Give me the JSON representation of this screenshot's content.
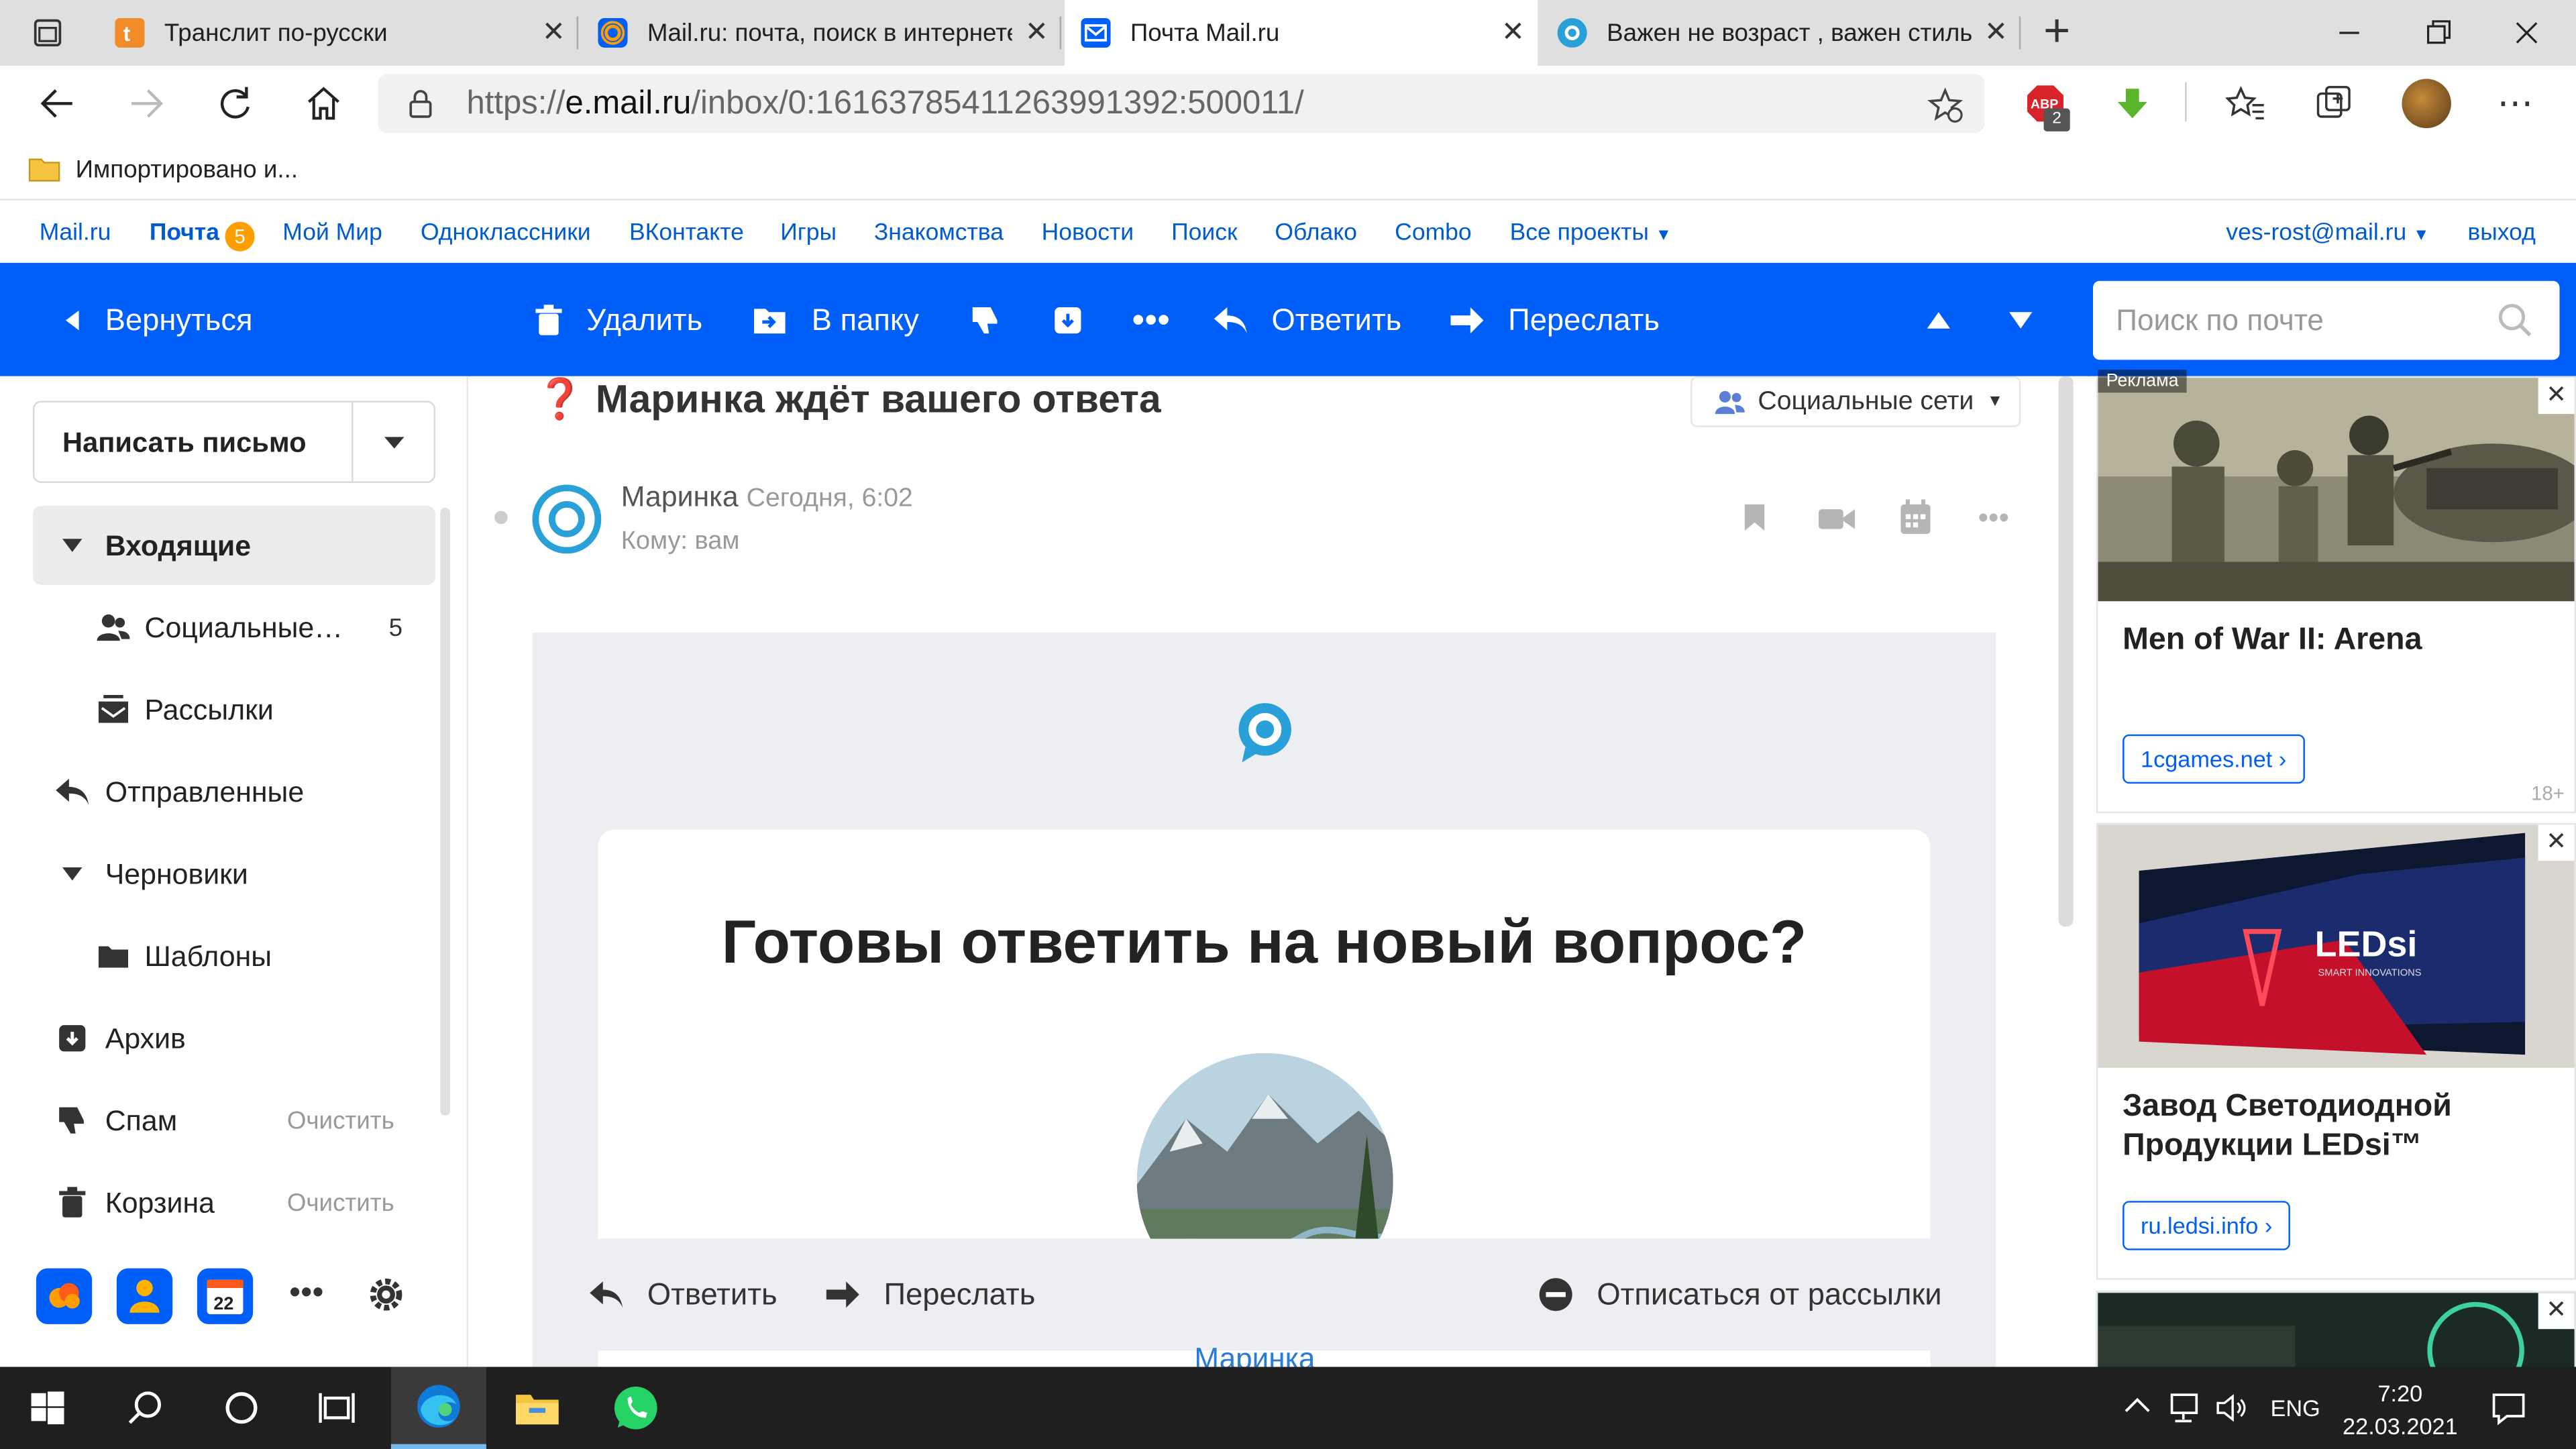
{
  "browser": {
    "tabs": [
      {
        "title": "Транслит по-русски",
        "icon": "translit-favicon"
      },
      {
        "title": "Mail.ru: почта, поиск в интернете",
        "icon": "mailru-at-favicon"
      },
      {
        "title": "Почта Mail.ru",
        "icon": "mail-envelope-favicon"
      },
      {
        "title": "Важен не возраст , важен стиль",
        "icon": "circle-favicon"
      }
    ],
    "new_tab": "+",
    "url_scheme": "https://",
    "url_domain": "e.mail.ru",
    "url_path": "/inbox/0:16163785411263991392:500011/",
    "adblock_badge": "2",
    "bookmark_folder": "Импортировано и..."
  },
  "portal_nav": {
    "items": [
      "Mail.ru",
      "Почта",
      "Мой Мир",
      "Одноклассники",
      "ВКонтакте",
      "Игры",
      "Знакомства",
      "Новости",
      "Поиск",
      "Облако",
      "Combo",
      "Все проекты"
    ],
    "mail_badge": "5",
    "user": "ves-rost@mail.ru",
    "logout": "выход"
  },
  "toolbar": {
    "back": "Вернуться",
    "delete": "Удалить",
    "to_folder": "В папку",
    "reply": "Ответить",
    "forward": "Переслать",
    "search_placeholder": "Поиск по почте"
  },
  "sidebar": {
    "compose": "Написать письмо",
    "folders": [
      {
        "label": "Входящие",
        "icon": "triangle-down-icon"
      },
      {
        "label": "Социальные…",
        "count": "5",
        "icon": "social-people-icon"
      },
      {
        "label": "Рассылки",
        "icon": "newsletter-icon"
      },
      {
        "label": "Отправленные",
        "icon": "reply-arrow-icon"
      },
      {
        "label": "Черновики",
        "icon": "triangle-down-icon"
      },
      {
        "label": "Шаблоны",
        "icon": "folder-icon"
      },
      {
        "label": "Архив",
        "icon": "archive-icon"
      },
      {
        "label": "Спам",
        "clear": "Очистить",
        "icon": "thumbs-down-icon"
      },
      {
        "label": "Корзина",
        "clear": "Очистить",
        "icon": "trash-icon"
      }
    ],
    "calendar_day": "22"
  },
  "message": {
    "subject": "Маринка ждёт вашего ответа",
    "category": "Социальные сети",
    "sender": "Маринка",
    "time": "Сегодня, 6:02",
    "to": "Кому: вам",
    "headline": "Готовы ответить на новый вопрос?",
    "footer_name": "Маринка"
  },
  "reply_bar": {
    "reply": "Ответить",
    "forward": "Переслать",
    "unsubscribe": "Отписаться от рассылки"
  },
  "ads": {
    "label": "Реклама",
    "items": [
      {
        "title": "Men of War II: Arena",
        "link": "1cgames.net",
        "age": "18+"
      },
      {
        "title": "Завод Светодиодной Продукции LEDsi™",
        "link": "ru.ledsi.info",
        "brand": "LEDsi",
        "brand_sub": "SMART INNOVATIONS"
      }
    ]
  },
  "taskbar": {
    "lang": "ENG",
    "time": "7:20",
    "date": "22.03.2021"
  },
  "colors": {
    "toolbar": "#005ff9",
    "link": "#005bd1",
    "badge": "#ff9e00"
  }
}
